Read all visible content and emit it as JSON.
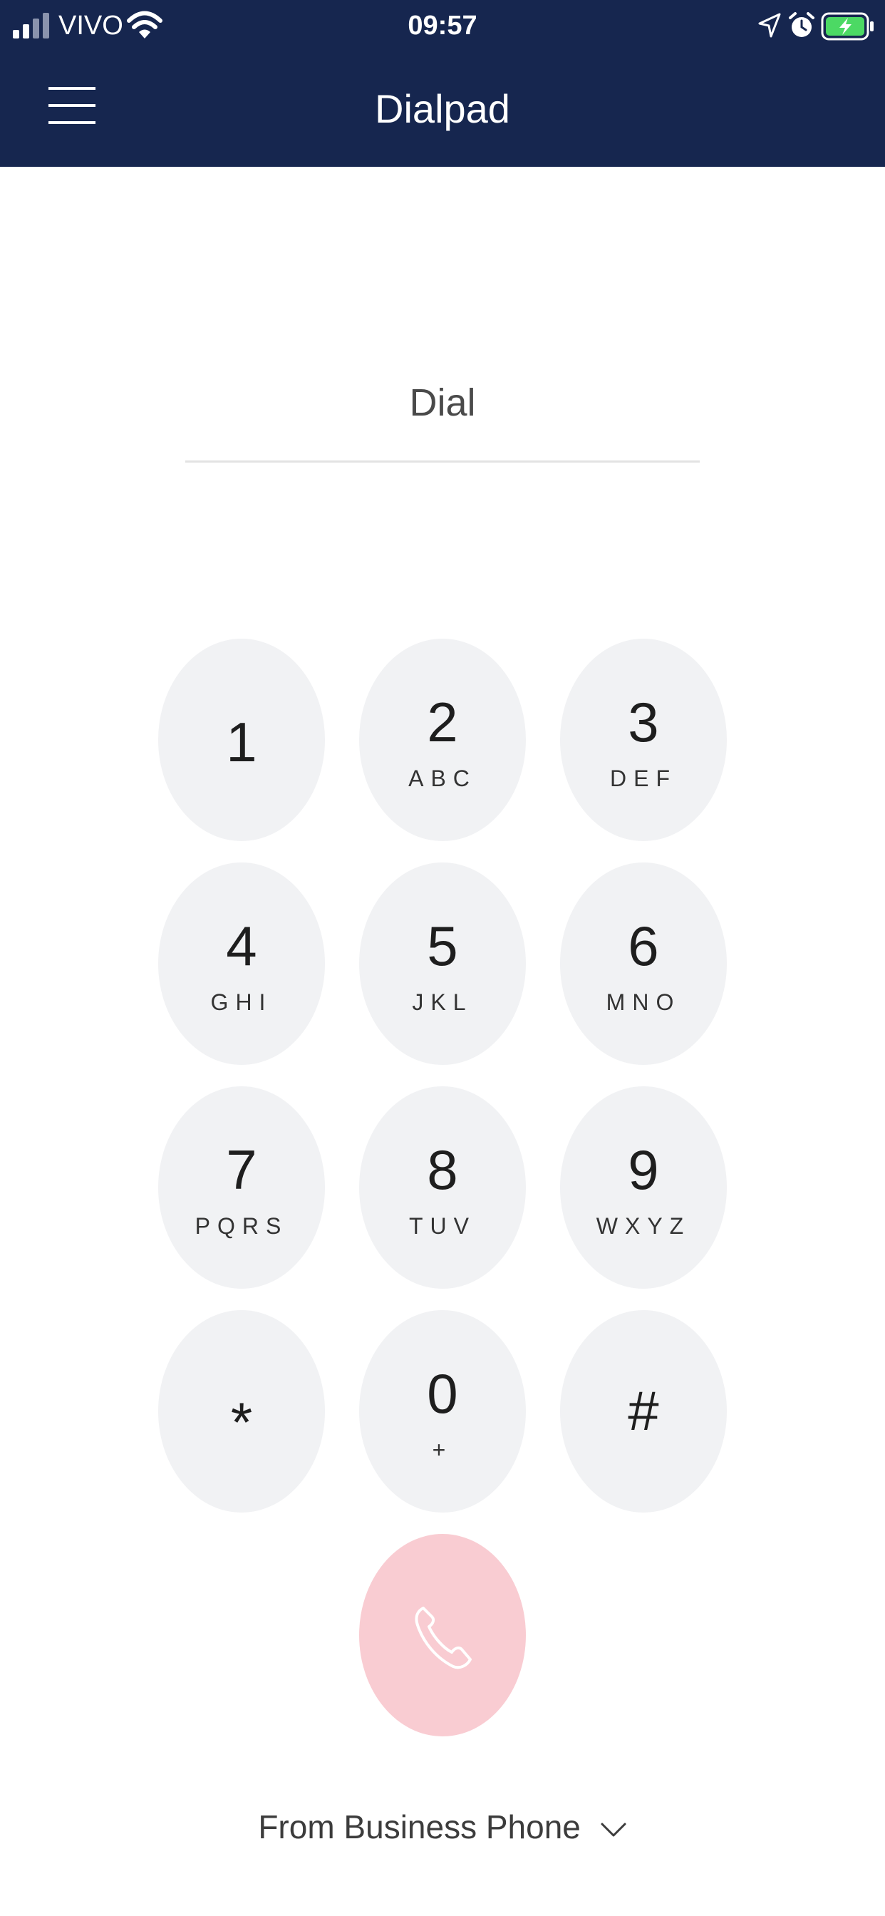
{
  "status_bar": {
    "carrier": "VIVO",
    "time": "09:57"
  },
  "header": {
    "title": "Dialpad"
  },
  "dial": {
    "placeholder": "Dial"
  },
  "keypad": [
    {
      "digit": "1",
      "letters": ""
    },
    {
      "digit": "2",
      "letters": "ABC"
    },
    {
      "digit": "3",
      "letters": "DEF"
    },
    {
      "digit": "4",
      "letters": "GHI"
    },
    {
      "digit": "5",
      "letters": "JKL"
    },
    {
      "digit": "6",
      "letters": "MNO"
    },
    {
      "digit": "7",
      "letters": "PQRS"
    },
    {
      "digit": "8",
      "letters": "TUV"
    },
    {
      "digit": "9",
      "letters": "WXYZ"
    },
    {
      "digit": "*",
      "letters": ""
    },
    {
      "digit": "0",
      "letters": "+"
    },
    {
      "digit": "#",
      "letters": ""
    }
  ],
  "footer": {
    "from_label": "From Business Phone"
  },
  "colors": {
    "header_bg": "#16264f",
    "key_bg": "#f1f2f4",
    "call_bg": "#f9ccd2",
    "battery_fill": "#4cd964"
  }
}
